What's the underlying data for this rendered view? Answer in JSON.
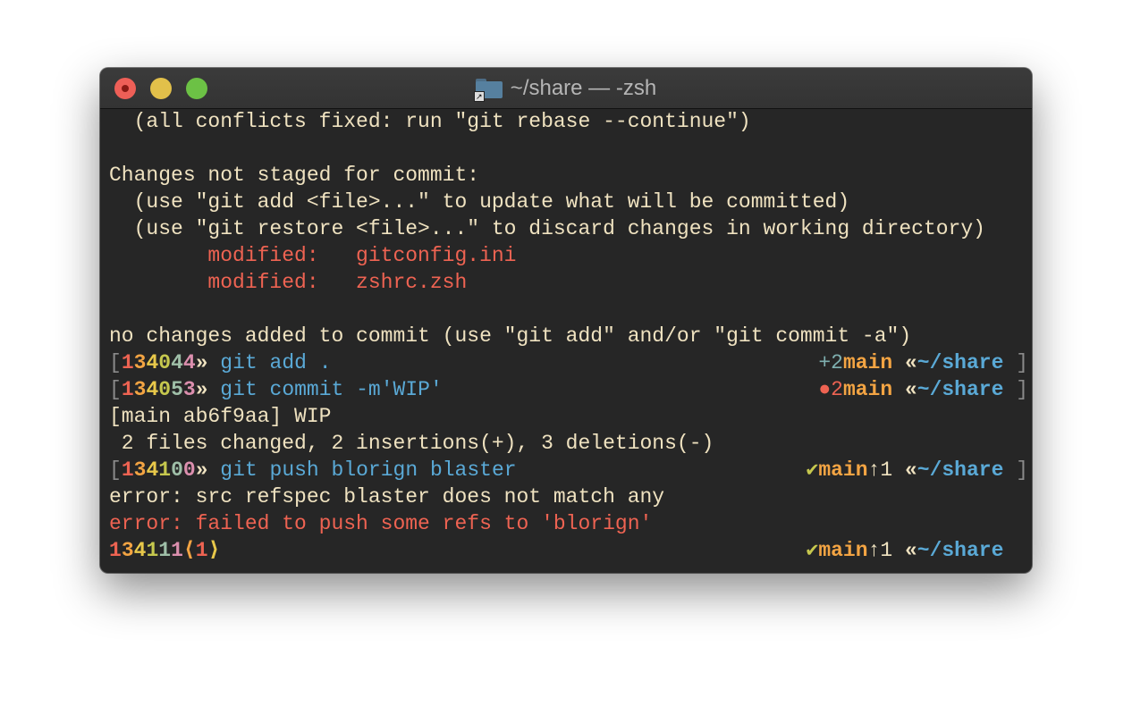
{
  "window": {
    "title": "~/share — -zsh",
    "title_icon": "folder-alias-icon"
  },
  "colors": {
    "text": "#efe2c0",
    "blue": "#5aa9d6",
    "red": "#ee6352",
    "orange": "#f3a443",
    "yellow": "#e8c84a",
    "lime": "#c6c84e",
    "sage": "#9fbfa8",
    "pink": "#dc8fae",
    "teal": "#7fb0b0",
    "grey": "#8a8a8a",
    "check": "#c6c84e"
  },
  "lines": [
    {
      "left": [
        {
          "t": "  (all conflicts fixed: run \"git rebase --continue\")",
          "c": "text"
        }
      ],
      "right": []
    },
    {
      "left": [],
      "right": []
    },
    {
      "left": [
        {
          "t": "Changes not staged for commit:",
          "c": "text"
        }
      ],
      "right": []
    },
    {
      "left": [
        {
          "t": "  (use \"git add <file>...\" to update what will be committed)",
          "c": "text"
        }
      ],
      "right": []
    },
    {
      "left": [
        {
          "t": "  (use \"git restore <file>...\" to discard changes in working directory)",
          "c": "text"
        }
      ],
      "right": []
    },
    {
      "left": [
        {
          "t": "        modified:   gitconfig.ini",
          "c": "red"
        }
      ],
      "right": []
    },
    {
      "left": [
        {
          "t": "        modified:   zshrc.zsh",
          "c": "red"
        }
      ],
      "right": []
    },
    {
      "left": [],
      "right": []
    },
    {
      "left": [
        {
          "t": "no changes added to commit (use \"git add\" and/or \"git commit -a\")",
          "c": "text"
        }
      ],
      "right": []
    },
    {
      "left": [
        {
          "t": "[",
          "c": "grey"
        },
        {
          "t": "1",
          "c": "red",
          "b": 1
        },
        {
          "t": "3",
          "c": "orange",
          "b": 1
        },
        {
          "t": "4",
          "c": "yellow",
          "b": 1
        },
        {
          "t": "0",
          "c": "lime",
          "b": 1
        },
        {
          "t": "4",
          "c": "sage",
          "b": 1
        },
        {
          "t": "4",
          "c": "pink",
          "b": 1
        },
        {
          "t": "»",
          "c": "text",
          "b": 1
        },
        {
          "t": " git add .",
          "c": "blue"
        }
      ],
      "right": [
        {
          "t": "+2",
          "c": "teal"
        },
        {
          "t": "main",
          "c": "orange",
          "b": 1
        },
        {
          "t": " «",
          "c": "text",
          "b": 1
        },
        {
          "t": "~/share",
          "c": "blue",
          "b": 1
        },
        {
          "t": " ]",
          "c": "grey"
        }
      ]
    },
    {
      "left": [
        {
          "t": "[",
          "c": "grey"
        },
        {
          "t": "1",
          "c": "red",
          "b": 1
        },
        {
          "t": "3",
          "c": "orange",
          "b": 1
        },
        {
          "t": "4",
          "c": "yellow",
          "b": 1
        },
        {
          "t": "0",
          "c": "lime",
          "b": 1
        },
        {
          "t": "5",
          "c": "sage",
          "b": 1
        },
        {
          "t": "3",
          "c": "pink",
          "b": 1
        },
        {
          "t": "»",
          "c": "text",
          "b": 1
        },
        {
          "t": " git commit -m'WIP'",
          "c": "blue"
        }
      ],
      "right": [
        {
          "t": "●2",
          "c": "red"
        },
        {
          "t": "main",
          "c": "orange",
          "b": 1
        },
        {
          "t": " «",
          "c": "text",
          "b": 1
        },
        {
          "t": "~/share",
          "c": "blue",
          "b": 1
        },
        {
          "t": " ]",
          "c": "grey"
        }
      ]
    },
    {
      "left": [
        {
          "t": "[main ab6f9aa] WIP",
          "c": "text"
        }
      ],
      "right": []
    },
    {
      "left": [
        {
          "t": " 2 files changed, 2 insertions(+), 3 deletions(-)",
          "c": "text"
        }
      ],
      "right": []
    },
    {
      "left": [
        {
          "t": "[",
          "c": "grey"
        },
        {
          "t": "1",
          "c": "red",
          "b": 1
        },
        {
          "t": "3",
          "c": "orange",
          "b": 1
        },
        {
          "t": "4",
          "c": "yellow",
          "b": 1
        },
        {
          "t": "1",
          "c": "lime",
          "b": 1
        },
        {
          "t": "0",
          "c": "sage",
          "b": 1
        },
        {
          "t": "0",
          "c": "pink",
          "b": 1
        },
        {
          "t": "»",
          "c": "text",
          "b": 1
        },
        {
          "t": " git push blorign blaster",
          "c": "blue"
        }
      ],
      "right": [
        {
          "t": "✔",
          "c": "check"
        },
        {
          "t": "main",
          "c": "orange",
          "b": 1
        },
        {
          "t": "↑1",
          "c": "text"
        },
        {
          "t": " «",
          "c": "text",
          "b": 1
        },
        {
          "t": "~/share",
          "c": "blue",
          "b": 1
        },
        {
          "t": " ]",
          "c": "grey"
        }
      ]
    },
    {
      "left": [
        {
          "t": "error: src refspec blaster does not match any",
          "c": "text"
        }
      ],
      "right": []
    },
    {
      "left": [
        {
          "t": "error: failed to push some refs to 'blorign'",
          "c": "red"
        }
      ],
      "right": []
    },
    {
      "left": [
        {
          "t": "1",
          "c": "red",
          "b": 1
        },
        {
          "t": "3",
          "c": "orange",
          "b": 1
        },
        {
          "t": "4",
          "c": "yellow",
          "b": 1
        },
        {
          "t": "1",
          "c": "lime",
          "b": 1
        },
        {
          "t": "1",
          "c": "sage",
          "b": 1
        },
        {
          "t": "1",
          "c": "pink",
          "b": 1
        },
        {
          "t": "⟨",
          "c": "orange",
          "b": 1
        },
        {
          "t": "1",
          "c": "red",
          "b": 1
        },
        {
          "t": "⟩",
          "c": "yellow",
          "b": 1
        }
      ],
      "right": [
        {
          "t": "✔",
          "c": "check"
        },
        {
          "t": "main",
          "c": "orange",
          "b": 1
        },
        {
          "t": "↑1",
          "c": "text"
        },
        {
          "t": " «",
          "c": "text",
          "b": 1
        },
        {
          "t": "~/share",
          "c": "blue",
          "b": 1
        },
        {
          "t": "  ",
          "c": "grey"
        }
      ]
    }
  ]
}
